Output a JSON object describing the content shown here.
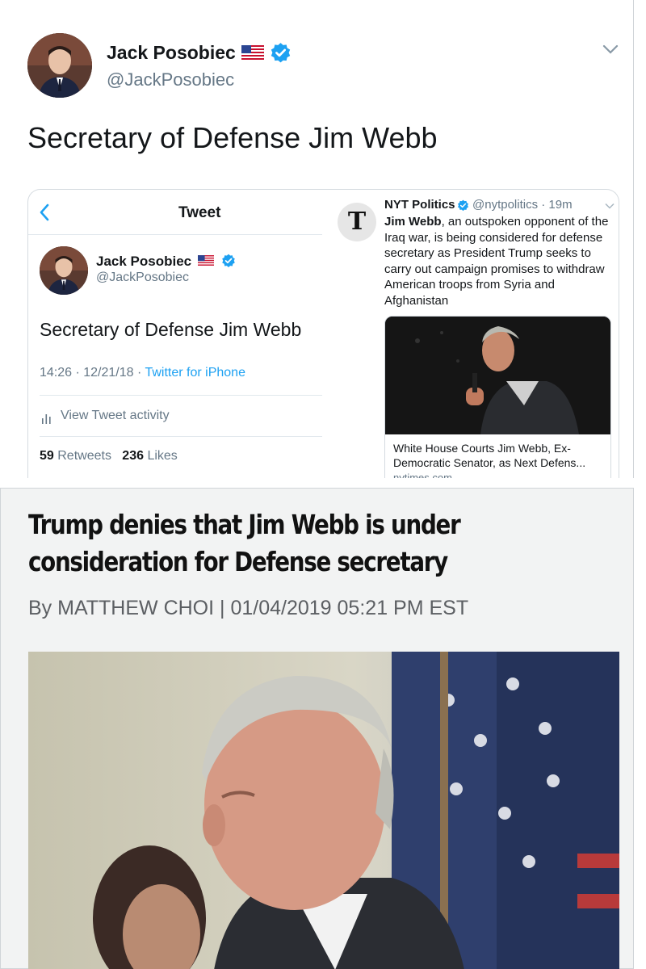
{
  "main_tweet": {
    "display_name": "Jack Posobiec",
    "handle": "@JackPosobiec",
    "text": "Secretary of Defense Jim Webb",
    "icons": [
      "us-flag-icon",
      "verified-badge-icon",
      "chevron-down-icon"
    ]
  },
  "embedded_tweet": {
    "header_title": "Tweet",
    "display_name": "Jack Posobiec",
    "handle": "@JackPosobiec",
    "text": "Secretary of Defense Jim Webb",
    "time_date": "14:26 · 12/21/18 · ",
    "source": "Twitter for iPhone",
    "activity_label": "View Tweet activity",
    "retweets_count": "59",
    "retweets_label": "Retweets",
    "likes_count": "236",
    "likes_label": "Likes"
  },
  "nyt_tweet": {
    "logo_letter": "T",
    "display_name": "NYT Politics",
    "handle_time": "@nytpolitics · 19m",
    "body_bold": "Jim Webb",
    "body_rest": ", an outspoken opponent of the Iraq war, is being considered for defense secretary as President Trump seeks to carry out campaign promises to withdraw American troops from Syria and Afghanistan",
    "link_title": "White House Courts Jim Webb, Ex-Democratic Senator, as Next Defens...",
    "link_domain": "nytimes.com"
  },
  "article": {
    "headline_line1": "Trump denies that Jim Webb is under",
    "headline_line2": "consideration for Defense secretary",
    "byline": "By MATTHEW CHOI | 01/04/2019 05:21 PM EST"
  },
  "colors": {
    "twitter_blue": "#1da1f2",
    "secondary_text": "#657786",
    "article_bg": "#f2f3f3"
  }
}
